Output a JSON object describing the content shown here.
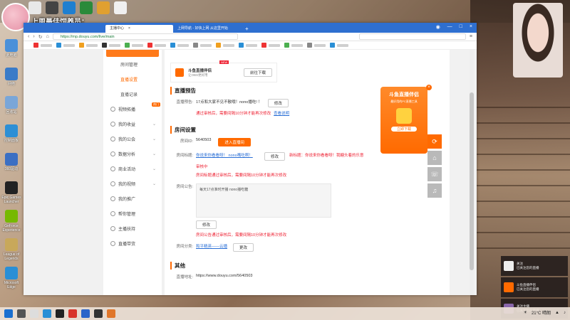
{
  "overlay": {
    "title": "上周最佳饲养员：",
    "name": "布欧"
  },
  "desktop": {
    "icons": [
      {
        "label": "此电脑",
        "color": "#4a90d9"
      },
      {
        "label": "网络",
        "color": "#3a7bc8"
      },
      {
        "label": "回收站",
        "color": "#7aa6d8"
      },
      {
        "label": "控制面板",
        "color": "#2d8fd5"
      },
      {
        "label": "360驱动",
        "color": "#3b6fc3"
      },
      {
        "label": "Epic Games Launcher",
        "color": "#222222"
      },
      {
        "label": "GeForce Experience",
        "color": "#76b900"
      },
      {
        "label": "League of Legends",
        "color": "#c8a85a"
      },
      {
        "label": "Microsoft Edge",
        "color": "#2a8fd6"
      }
    ]
  },
  "browser": {
    "tabs": [
      {
        "label": "主播中心",
        "active": true
      },
      {
        "label": "上网导航 - 好快上网 从这里开始",
        "active": false
      }
    ],
    "url": "https://mp.douyu.com/live/main"
  },
  "sidebar": {
    "sub_items": [
      "房间管理",
      "直播设置",
      "直播记录"
    ],
    "groups": [
      {
        "label": "视频拓播",
        "badge": "热门"
      },
      {
        "label": "我的收益"
      },
      {
        "label": "我的公会"
      },
      {
        "label": "数据分析"
      },
      {
        "label": "商业活动"
      },
      {
        "label": "我的视频"
      },
      {
        "label": "我的推广"
      },
      {
        "label": "帮你管理"
      },
      {
        "label": "主播扶持"
      },
      {
        "label": "直播带货"
      }
    ]
  },
  "content": {
    "promo": {
      "title": "斗鱼直播伴侣",
      "subtitle": "让OBS更好用",
      "new": "NEW",
      "download": "前往下载"
    },
    "preview": {
      "section": "直播预告",
      "label": "直播预告:",
      "value": "17点和大家不见不散哦！nono播吃! ！",
      "edit": "修改",
      "warn": "通过审核后，需要间隔10分钟才能再次修改",
      "explain": "查看说明"
    },
    "room": {
      "section": "房间设置",
      "id_label": "房间ID:",
      "id_value": "5640503",
      "enter": "进入直播间",
      "title_label": "房间标题:",
      "title_value": "你说来你看看呀！ nono嘴吃啊！",
      "edit": "修改",
      "title_warn1": "新标题：你说来你看看呀！我糖头着的乐意",
      "title_warn2": "审核中",
      "title_warn3": "房间标题通过审核后，需要间隔10分钟才能再次修改",
      "notice_label": "房间公告:",
      "notice_value": "每天17点准时开播 nono播吃糖",
      "notice_edit": "修改",
      "notice_warn": "房间公告通过审核后，需要间隔10分钟才能再次修改",
      "category_label": "房间分类:",
      "category_value": "和平精英——云播",
      "category_change": "更改"
    },
    "other": {
      "section": "其他",
      "addr_label": "直播地址:",
      "addr_value": "https://www.douyu.com/5640503"
    }
  },
  "float_ad": {
    "title": "斗鱼直播伴侣",
    "subtitle": "最好用的PC直播工具",
    "button": "立即下载"
  },
  "tools": [
    "⟳",
    "⌂",
    "☏",
    "♫"
  ],
  "taskbar": {
    "weather": "21°C 晴朗"
  },
  "notifications": [
    {
      "title": "关注",
      "body": "已关注您的直播",
      "color": "#eeeeee"
    },
    {
      "title": "斗鱼直播伴侣",
      "body": "已关注您的直播",
      "color": "#ff6a00"
    },
    {
      "title": "关注主播",
      "body": "已关注您的直播",
      "color": "#8866aa"
    }
  ]
}
